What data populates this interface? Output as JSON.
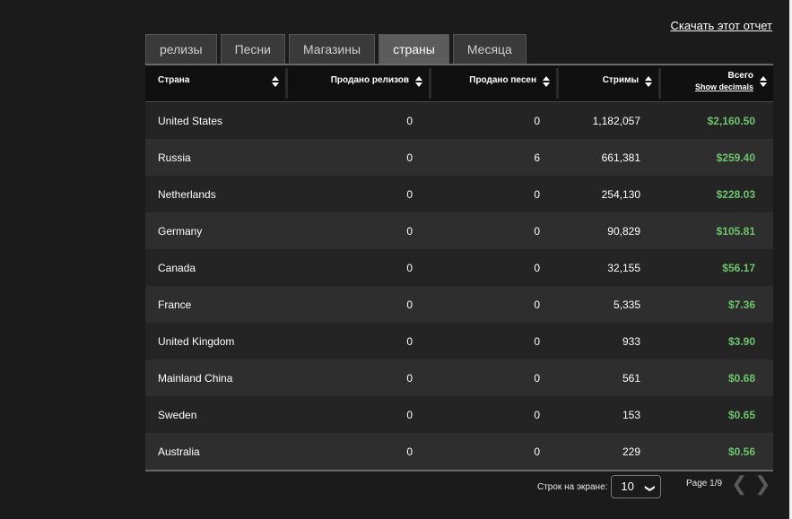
{
  "download_label": "Скачать этот отчет",
  "tabs": [
    {
      "label": "релизы"
    },
    {
      "label": "Песни"
    },
    {
      "label": "Магазины"
    },
    {
      "label": "страны"
    },
    {
      "label": "Месяца"
    }
  ],
  "active_tab": "страны",
  "table": {
    "columns": [
      "Страна",
      "Продано релизов",
      "Продано песен",
      "Стримы",
      "Всего"
    ],
    "show_decimals_label": "Show decimals",
    "rows": [
      {
        "country": "United States",
        "releases": "0",
        "songs": "0",
        "streams": "1,182,057",
        "total": "$2,160.50"
      },
      {
        "country": "Russia",
        "releases": "0",
        "songs": "6",
        "streams": "661,381",
        "total": "$259.40"
      },
      {
        "country": "Netherlands",
        "releases": "0",
        "songs": "0",
        "streams": "254,130",
        "total": "$228.03"
      },
      {
        "country": "Germany",
        "releases": "0",
        "songs": "0",
        "streams": "90,829",
        "total": "$105.81"
      },
      {
        "country": "Canada",
        "releases": "0",
        "songs": "0",
        "streams": "32,155",
        "total": "$56.17"
      },
      {
        "country": "France",
        "releases": "0",
        "songs": "0",
        "streams": "5,335",
        "total": "$7.36"
      },
      {
        "country": "United Kingdom",
        "releases": "0",
        "songs": "0",
        "streams": "933",
        "total": "$3.90"
      },
      {
        "country": "Mainland China",
        "releases": "0",
        "songs": "0",
        "streams": "561",
        "total": "$0.68"
      },
      {
        "country": "Sweden",
        "releases": "0",
        "songs": "0",
        "streams": "153",
        "total": "$0.65"
      },
      {
        "country": "Australia",
        "releases": "0",
        "songs": "0",
        "streams": "229",
        "total": "$0.56"
      }
    ]
  },
  "pagination": {
    "rows_label": "Строк на экране:",
    "rows_value": "10",
    "page_info": "Page 1/9",
    "prev_icon": "chevron-left-icon",
    "next_icon": "chevron-right-icon"
  },
  "colors": {
    "background": "#1b1b1b",
    "active_tab": "#5c5c5c",
    "total_green": "#6ec46e"
  }
}
